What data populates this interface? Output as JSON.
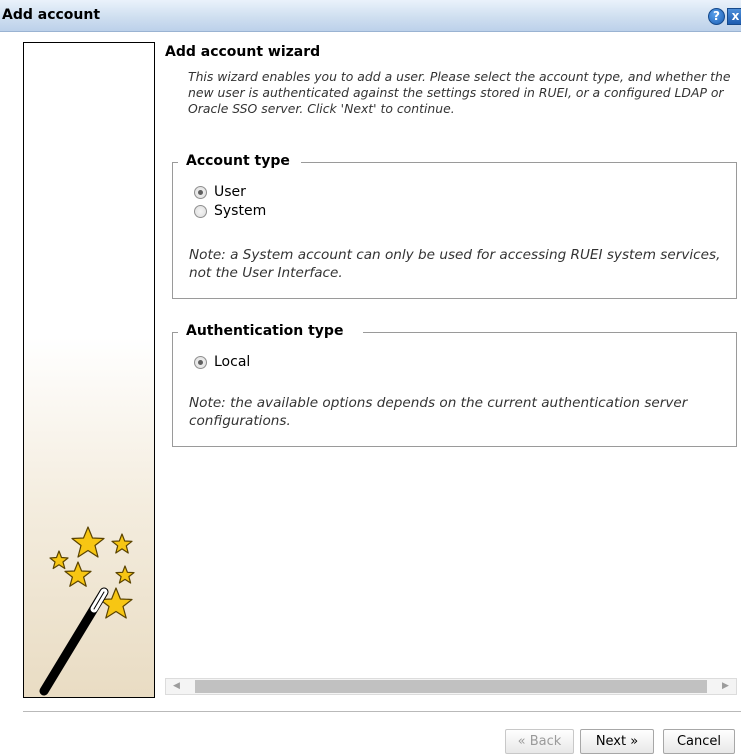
{
  "window": {
    "title": "Add account",
    "help_symbol": "?",
    "close_symbol": "x"
  },
  "wizard": {
    "title": "Add account wizard",
    "intro": "This wizard enables you to add a user. Please select the account type, and whether the new user is authenticated against the settings stored in RUEI, or a configured LDAP or Oracle SSO server. Click 'Next' to continue."
  },
  "account_type": {
    "legend": "Account type",
    "options": [
      {
        "label": "User",
        "selected": true
      },
      {
        "label": "System",
        "selected": false
      }
    ],
    "note": "Note: a System account can only be used for accessing RUEI system services, not the User Interface."
  },
  "authentication_type": {
    "legend": "Authentication type",
    "options": [
      {
        "label": "Local",
        "selected": true
      }
    ],
    "note": "Note: the available options depends on the current authentication server configurations."
  },
  "scrollbar": {
    "left_arrow": "◀",
    "right_arrow": "▶"
  },
  "buttons": {
    "back": "« Back",
    "back_enabled": false,
    "next": "Next »",
    "cancel": "Cancel"
  },
  "icons": {
    "help": "help-icon",
    "close": "close-icon",
    "wizard": "magic-wand-icon"
  }
}
